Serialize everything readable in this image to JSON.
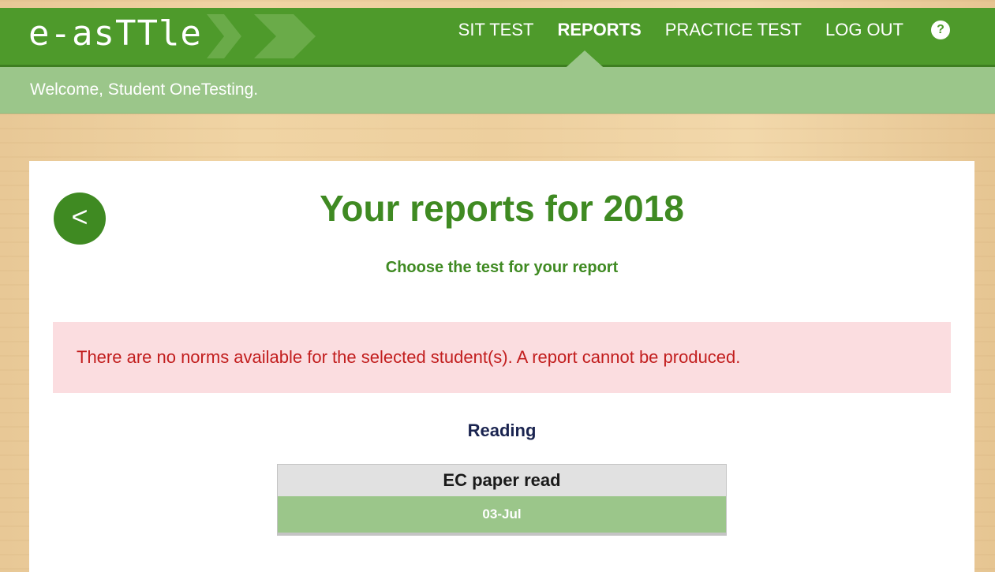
{
  "header": {
    "logo": "e-asTTle",
    "nav": [
      {
        "label": "SIT TEST",
        "active": false
      },
      {
        "label": "REPORTS",
        "active": true
      },
      {
        "label": "PRACTICE TEST",
        "active": false
      },
      {
        "label": "LOG OUT",
        "active": false
      }
    ],
    "help_label": "?",
    "colors": {
      "primary": "#4e9a2b",
      "light": "#9bc68a"
    }
  },
  "welcome": "Welcome, Student OneTesting.",
  "main": {
    "back_label": "<",
    "title": "Your reports for 2018",
    "subtitle": "Choose the test for your report",
    "alert": "There are no norms available for the selected student(s). A report cannot be produced.",
    "section": "Reading",
    "test": {
      "name": "EC paper read",
      "date": "03-Jul"
    }
  }
}
